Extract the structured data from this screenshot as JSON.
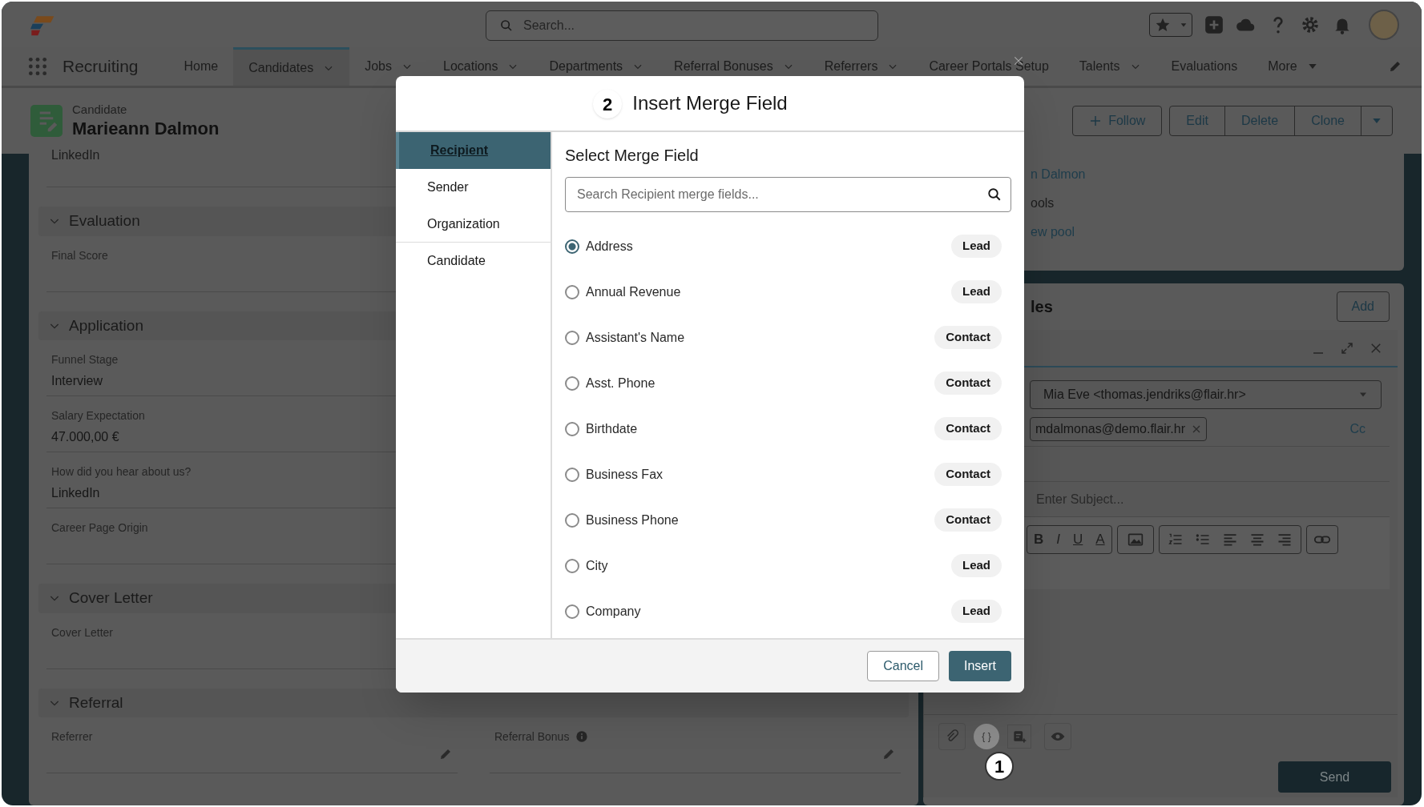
{
  "app": {
    "name": "Recruiting"
  },
  "header": {
    "search_placeholder": "Search..."
  },
  "nav": [
    {
      "label": "Home",
      "selected": false,
      "dropdown": false,
      "kind": "tab"
    },
    {
      "label": "Candidates",
      "selected": true,
      "dropdown": true,
      "kind": "tab"
    },
    {
      "label": "Jobs",
      "selected": false,
      "dropdown": true,
      "kind": "tab"
    },
    {
      "label": "Locations",
      "selected": false,
      "dropdown": true,
      "kind": "tab"
    },
    {
      "label": "Departments",
      "selected": false,
      "dropdown": true,
      "kind": "tab"
    },
    {
      "label": "Referral Bonuses",
      "selected": false,
      "dropdown": true,
      "kind": "tab"
    },
    {
      "label": "Referrers",
      "selected": false,
      "dropdown": true,
      "kind": "tab"
    },
    {
      "label": "Career Portals Setup",
      "selected": false,
      "dropdown": false,
      "kind": "tab"
    },
    {
      "label": "Talents",
      "selected": false,
      "dropdown": true,
      "kind": "tab"
    },
    {
      "label": "Evaluations",
      "selected": false,
      "dropdown": false,
      "kind": "tab"
    },
    {
      "label": "More",
      "selected": false,
      "dropdown": true,
      "kind": "overflow"
    }
  ],
  "record": {
    "type_label": "Candidate",
    "name": "Marieann Dalmon",
    "actions": [
      "Follow",
      "Edit",
      "Delete",
      "Clone"
    ]
  },
  "details": {
    "top_value": "LinkedIn",
    "sections": [
      {
        "title": "Evaluation",
        "kind": "single",
        "fields": [
          {
            "label": "Final Score"
          }
        ]
      },
      {
        "title": "Application",
        "kind": "single",
        "fields": [
          {
            "label": "Funnel Stage",
            "value": "Interview"
          },
          {
            "label": "Salary Expectation",
            "value": "47.000,00 €"
          },
          {
            "label": "How did you hear about us?",
            "value": "LinkedIn"
          },
          {
            "label": "Career Page Origin"
          }
        ]
      },
      {
        "title": "Cover Letter",
        "kind": "single",
        "fields": [
          {
            "label": "Cover Letter"
          }
        ]
      },
      {
        "title": "Referral",
        "kind": "pair",
        "fields": [
          {
            "label": "Referrer",
            "info": false
          },
          {
            "label": "Referral Bonus",
            "info": true
          }
        ]
      }
    ]
  },
  "side_card": {
    "lines": [
      {
        "text": "n Dalmon",
        "kind": "link"
      },
      {
        "text": "ools",
        "kind": "text"
      },
      {
        "text": "ew pool",
        "kind": "link"
      }
    ]
  },
  "related": {
    "title": "les",
    "action": "Add"
  },
  "composer": {
    "from": "Mia Eve <thomas.jendriks@flair.hr>",
    "to": [
      "mdalmonas@demo.flair.hr"
    ],
    "cc": "Cc",
    "subject_placeholder": "Enter Subject...",
    "format_buttons": [
      "B",
      "I",
      "U",
      "A"
    ],
    "send": "Send",
    "step": "1",
    "merge_button": "{ }"
  },
  "modal": {
    "title": "Insert Merge Field",
    "step": "2",
    "heading": "Select Merge Field",
    "search_placeholder": "Search Recipient merge fields...",
    "categories": [
      {
        "label": "Recipient",
        "selected": true
      },
      {
        "label": "Sender",
        "selected": false
      },
      {
        "label": "Organization",
        "selected": false
      },
      {
        "label": "Candidate",
        "selected": false
      }
    ],
    "fields": [
      {
        "label": "Address",
        "object": "Lead",
        "selected": true
      },
      {
        "label": "Annual Revenue",
        "object": "Lead",
        "selected": false
      },
      {
        "label": "Assistant's Name",
        "object": "Contact",
        "selected": false
      },
      {
        "label": "Asst. Phone",
        "object": "Contact",
        "selected": false
      },
      {
        "label": "Birthdate",
        "object": "Contact",
        "selected": false
      },
      {
        "label": "Business Fax",
        "object": "Contact",
        "selected": false
      },
      {
        "label": "Business Phone",
        "object": "Contact",
        "selected": false
      },
      {
        "label": "City",
        "object": "Lead",
        "selected": false
      },
      {
        "label": "Company",
        "object": "Lead",
        "selected": false
      }
    ],
    "cancel": "Cancel",
    "confirm": "Insert"
  }
}
